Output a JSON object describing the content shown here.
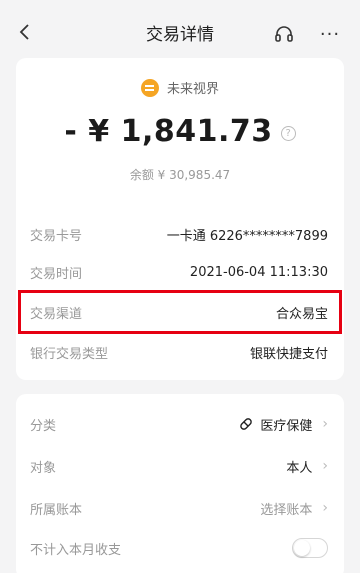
{
  "header": {
    "title": "交易详情",
    "back_icon": "chevron-left-icon",
    "support_icon": "headset-icon",
    "more_label": "···"
  },
  "summary": {
    "merchant_icon": "wallet-icon",
    "merchant_color": "#f5a524",
    "merchant": "未来视界",
    "amount": "- ¥ 1,841.73",
    "help_label": "?",
    "balance": "余额 ¥ 30,985.47"
  },
  "details": [
    {
      "label": "交易卡号",
      "value": "一卡通 6226********7899"
    },
    {
      "label": "交易时间",
      "value": "2021-06-04 11:13:30"
    },
    {
      "label": "交易渠道",
      "value": "合众易宝"
    },
    {
      "label": "银行交易类型",
      "value": "银联快捷支付"
    }
  ],
  "highlight_color": "#e60012",
  "settings": [
    {
      "label": "分类",
      "value": "医疗保健",
      "icon": "pill-icon"
    },
    {
      "label": "对象",
      "value": "本人"
    },
    {
      "label": "所属账本",
      "value": "选择账本"
    },
    {
      "label": "不计入本月收支",
      "toggle": false
    }
  ]
}
